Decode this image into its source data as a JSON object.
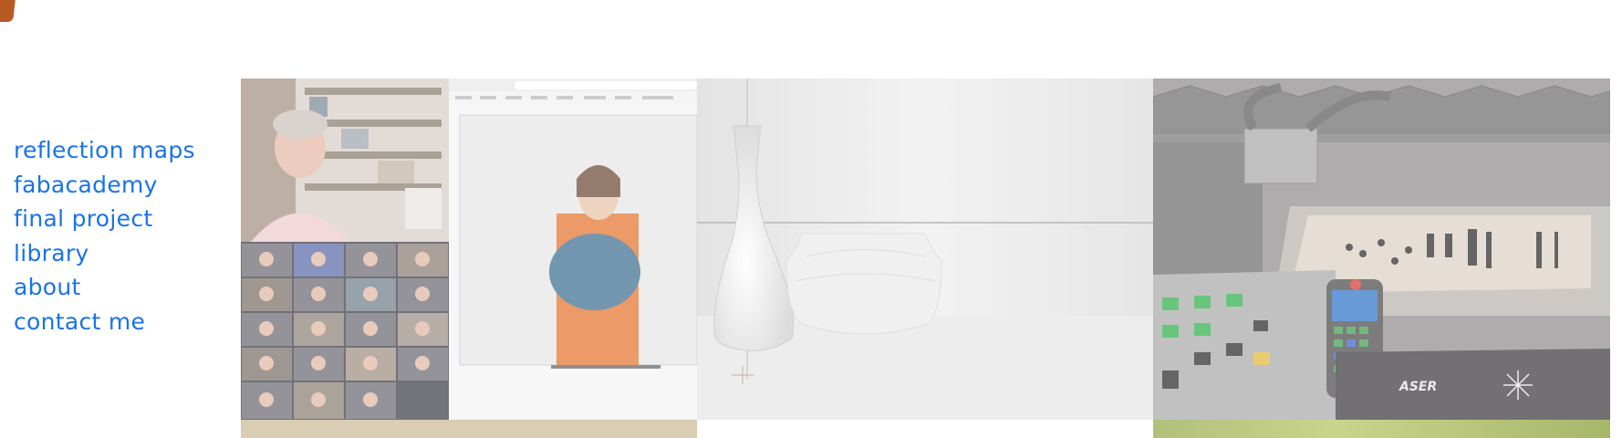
{
  "nav": {
    "items": [
      {
        "label": "reflection maps"
      },
      {
        "label": "fabacademy"
      },
      {
        "label": "final project"
      },
      {
        "label": "library"
      },
      {
        "label": "about"
      },
      {
        "label": "contact me"
      }
    ]
  },
  "gallery": {
    "tiles": [
      {
        "alt": "video conference and whiteboard lecture"
      },
      {
        "alt": "rendered vase and pot"
      },
      {
        "alt": "laser cutter machine"
      },
      {
        "alt": ""
      },
      {
        "alt": ""
      },
      {
        "alt": ""
      }
    ]
  },
  "colors": {
    "link": "#1a73e8",
    "logo": "#b75a22",
    "background": "#ffffff"
  }
}
